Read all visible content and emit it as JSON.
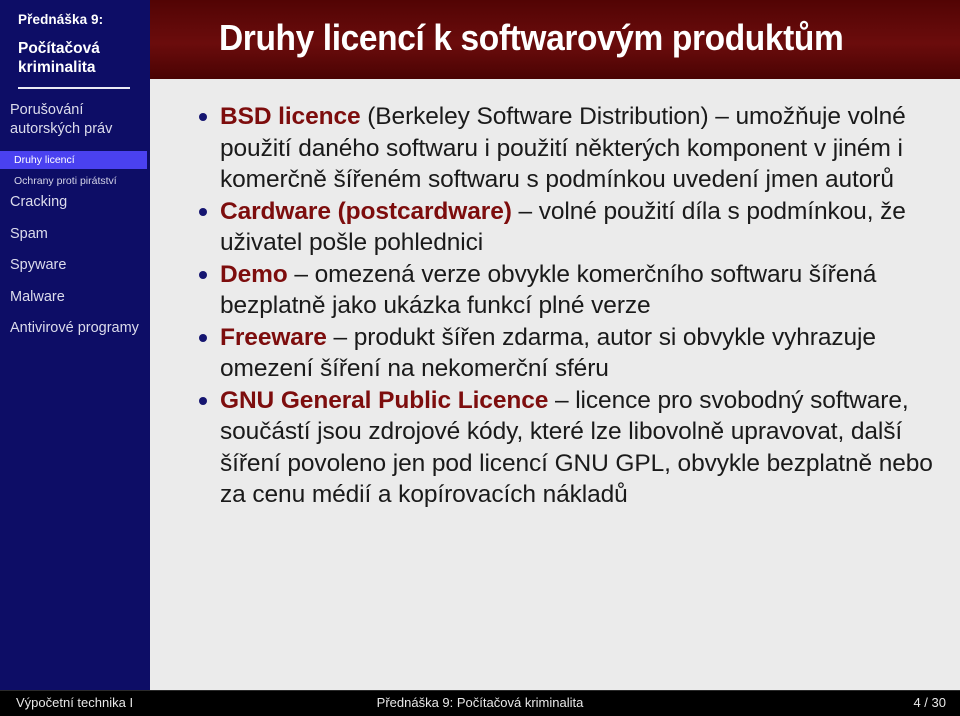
{
  "sidebar": {
    "lecture_label": "Přednáška 9:",
    "course_title_line1": "Počítačová",
    "course_title_line2": "kriminalita",
    "items": [
      {
        "label": "Porušování autorských práv",
        "level": 1,
        "active": false
      },
      {
        "label": "Druhy licencí",
        "level": 2,
        "active": true
      },
      {
        "label": "Ochrany proti pirátství",
        "level": 2,
        "active": false
      },
      {
        "label": "Cracking",
        "level": 1,
        "active": false
      },
      {
        "label": "Spam",
        "level": 1,
        "active": false
      },
      {
        "label": "Spyware",
        "level": 1,
        "active": false
      },
      {
        "label": "Malware",
        "level": 1,
        "active": false
      },
      {
        "label": "Antivirové programy",
        "level": 1,
        "active": false
      }
    ]
  },
  "header": {
    "title": "Druhy licencí k softwarovým produktům"
  },
  "main": {
    "bullets": [
      {
        "lead": "BSD licence",
        "rest": " (Berkeley Software Distribution) – umožňuje volné použití daného softwaru i použití některých komponent v jiném i komerčně šířeném softwaru s podmínkou uvedení jmen autorů"
      },
      {
        "lead": "Cardware (postcardware)",
        "rest": " – volné použití díla s podmínkou, že uživatel pošle pohlednici"
      },
      {
        "lead": "Demo",
        "rest": " – omezená verze obvykle komerčního softwaru šířená bezplatně jako ukázka funkcí plné verze"
      },
      {
        "lead": "Freeware",
        "rest": " – produkt šířen zdarma, autor si obvykle vyhrazuje omezení šíření na nekomerční sféru"
      },
      {
        "lead": "GNU General Public Licence",
        "rest": " – licence pro svobodný software, součástí jsou zdrojové kódy, které lze libovolně upravovat, další šíření povoleno jen pod licencí GNU GPL, obvykle bezplatně nebo za cenu médií a kopírovacích nákladů"
      }
    ]
  },
  "footer": {
    "left": "Výpočetní technika I",
    "center": "Přednáška 9: Počítačová kriminalita",
    "page": "4 / 30"
  },
  "colors": {
    "sidebar_bg": "#0d0d66",
    "sidebar_active": "#4a41f0",
    "titlebar_bg": "#5c0707",
    "content_bg": "#ebebeb",
    "lead_text": "#7d0d0d",
    "bullet_marker": "#151570",
    "footer_bg": "#000000"
  }
}
